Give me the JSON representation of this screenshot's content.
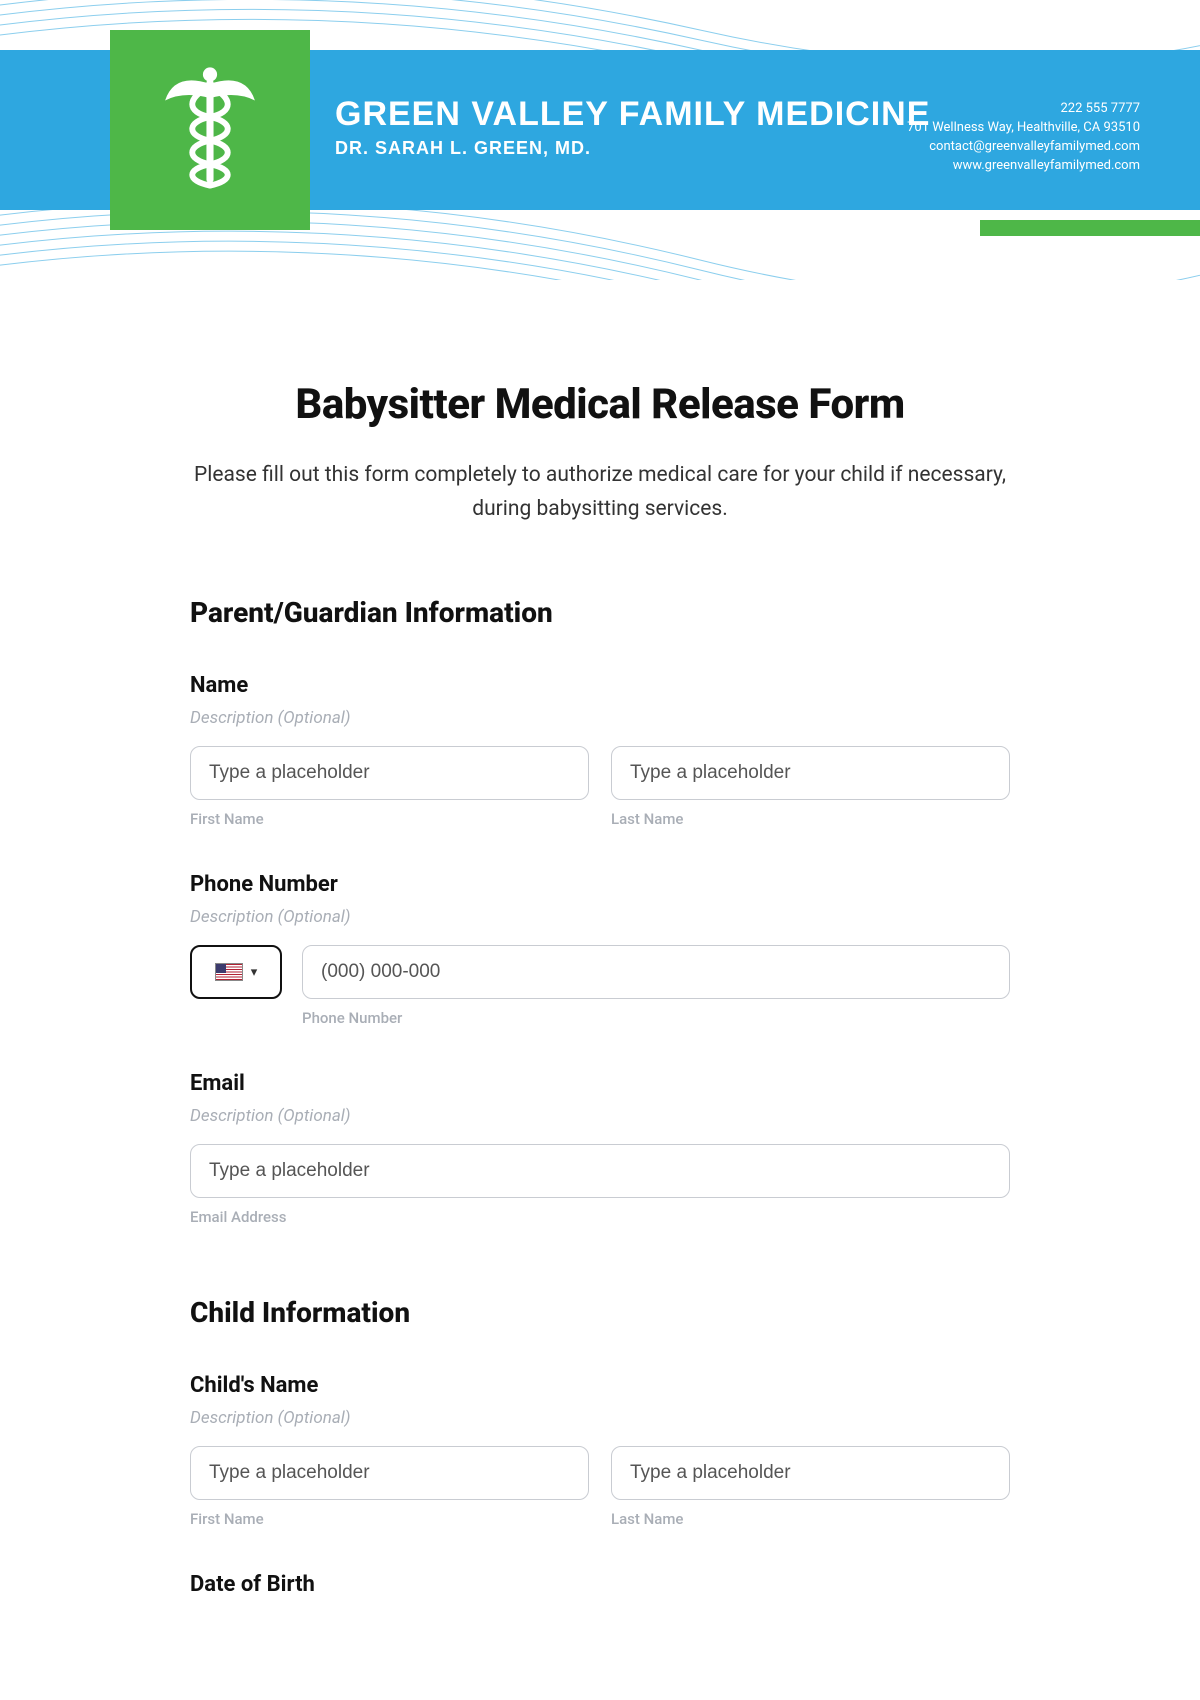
{
  "header": {
    "practice_name": "GREEN VALLEY FAMILY MEDICINE",
    "doctor_line": "DR. SARAH L. GREEN, MD.",
    "phone": "222 555 7777",
    "address": "701 Wellness Way, Healthville, CA 93510",
    "email": "contact@greenvalleyfamilymed.com",
    "website": "www.greenvalleyfamilymed.com"
  },
  "form": {
    "title": "Babysitter Medical Release Form",
    "intro": "Please fill out this form completely to authorize medical care for your child if necessary, during babysitting services."
  },
  "sections": {
    "parent": {
      "title": "Parent/Guardian Information",
      "name": {
        "label": "Name",
        "desc": "Description (Optional)",
        "first_placeholder": "Type a placeholder",
        "last_placeholder": "Type a placeholder",
        "first_sub": "First Name",
        "last_sub": "Last Name"
      },
      "phone": {
        "label": "Phone Number",
        "desc": "Description (Optional)",
        "placeholder": "(000) 000-000",
        "sub": "Phone Number"
      },
      "email": {
        "label": "Email",
        "desc": "Description (Optional)",
        "placeholder": "Type a placeholder",
        "sub": "Email Address"
      }
    },
    "child": {
      "title": "Child Information",
      "name": {
        "label": "Child's Name",
        "desc": "Description (Optional)",
        "first_placeholder": "Type a placeholder",
        "last_placeholder": "Type a placeholder",
        "first_sub": "First Name",
        "last_sub": "Last Name"
      },
      "dob": {
        "label": "Date of Birth"
      }
    }
  }
}
